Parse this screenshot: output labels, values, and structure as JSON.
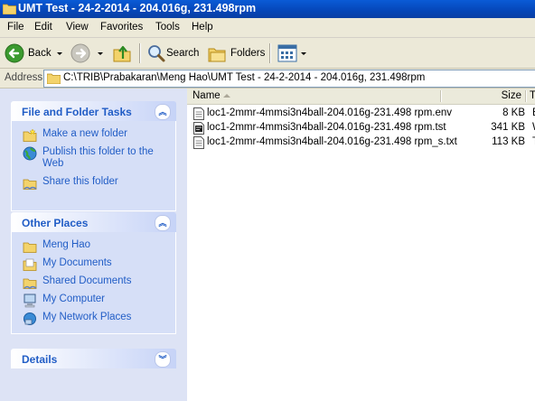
{
  "window": {
    "title": "UMT Test - 24-2-2014 - 204.016g, 231.498rpm"
  },
  "menu": [
    "File",
    "Edit",
    "View",
    "Favorites",
    "Tools",
    "Help"
  ],
  "toolbar": {
    "back_label": "Back",
    "search_label": "Search",
    "folders_label": "Folders"
  },
  "address": {
    "label": "Address",
    "path": "C:\\TRIB\\Prabakaran\\Meng Hao\\UMT Test - 24-2-2014 - 204.016g, 231.498rpm"
  },
  "tasks": {
    "file_folder": {
      "title": "File and Folder Tasks",
      "items": [
        "Make a new folder",
        "Publish this folder to the Web",
        "Share this folder"
      ]
    },
    "other_places": {
      "title": "Other Places",
      "items": [
        "Meng Hao",
        "My Documents",
        "Shared Documents",
        "My Computer",
        "My Network Places"
      ]
    },
    "details": {
      "title": "Details"
    }
  },
  "columns": {
    "name": "Name",
    "size": "Size",
    "type": "T"
  },
  "files": [
    {
      "name": "loc1-2mmr-4mmsi3n4ball-204.016g-231.498 rpm.env",
      "size": "8 KB",
      "type": "E",
      "icon": "text-file-icon"
    },
    {
      "name": "loc1-2mmr-4mmsi3n4ball-204.016g-231.498 rpm.tst",
      "size": "341 KB",
      "type": "W",
      "icon": "tst-file-icon"
    },
    {
      "name": "loc1-2mmr-4mmsi3n4ball-204.016g-231.498 rpm_s.txt",
      "size": "113 KB",
      "type": "T",
      "icon": "text-file-icon"
    }
  ],
  "colors": {
    "title_bar": "#0a4fc4",
    "task_link": "#215dc6",
    "left_pane": "#dde3f5"
  }
}
